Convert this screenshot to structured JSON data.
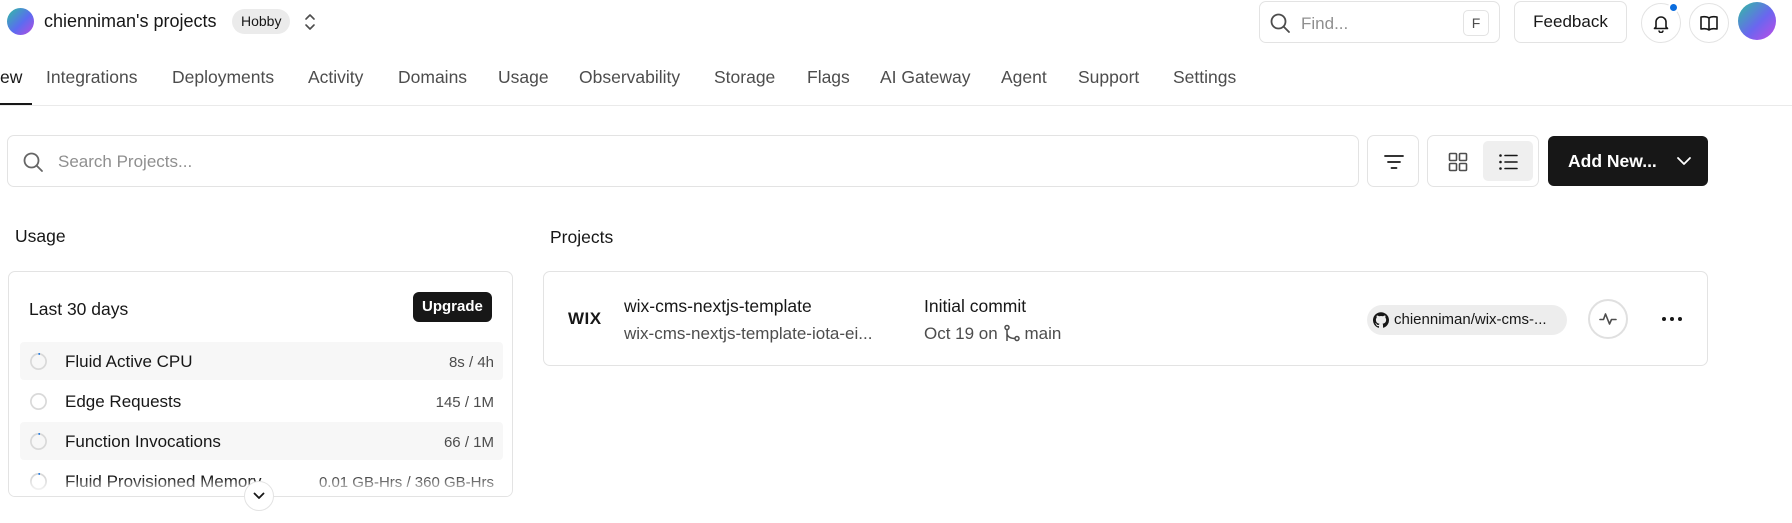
{
  "header": {
    "team_name": "chienniman's projects",
    "plan_badge": "Hobby",
    "find_placeholder": "Find...",
    "find_shortcut": "F",
    "feedback_label": "Feedback"
  },
  "nav": {
    "tabs": [
      {
        "label": "ew",
        "active": true
      },
      {
        "label": "Integrations"
      },
      {
        "label": "Deployments"
      },
      {
        "label": "Activity"
      },
      {
        "label": "Domains"
      },
      {
        "label": "Usage"
      },
      {
        "label": "Observability"
      },
      {
        "label": "Storage"
      },
      {
        "label": "Flags"
      },
      {
        "label": "AI Gateway"
      },
      {
        "label": "Agent"
      },
      {
        "label": "Support"
      },
      {
        "label": "Settings"
      }
    ]
  },
  "toolbar": {
    "search_placeholder": "Search Projects...",
    "add_new_label": "Add New..."
  },
  "usage": {
    "title": "Usage",
    "period": "Last 30 days",
    "upgrade_label": "Upgrade",
    "metrics": [
      {
        "name": "Fluid Active CPU",
        "value": "8s / 4h"
      },
      {
        "name": "Edge Requests",
        "value": "145 / 1M"
      },
      {
        "name": "Function Invocations",
        "value": "66 / 1M"
      },
      {
        "name": "Fluid Provisioned Memory",
        "value": "0.01 GB-Hrs / 360 GB-Hrs"
      }
    ]
  },
  "projects": {
    "title": "Projects",
    "items": [
      {
        "logo": "WIX",
        "name": "wix-cms-nextjs-template",
        "url": "wix-cms-nextjs-template-iota-ei...",
        "commit_message": "Initial commit",
        "commit_date": "Oct 19 on",
        "branch": "main",
        "repo": "chienniman/wix-cms-..."
      }
    ]
  },
  "colors": {
    "primary_button": "#171717",
    "notification_dot": "#0b6dde",
    "border": "#e3e3e3"
  }
}
